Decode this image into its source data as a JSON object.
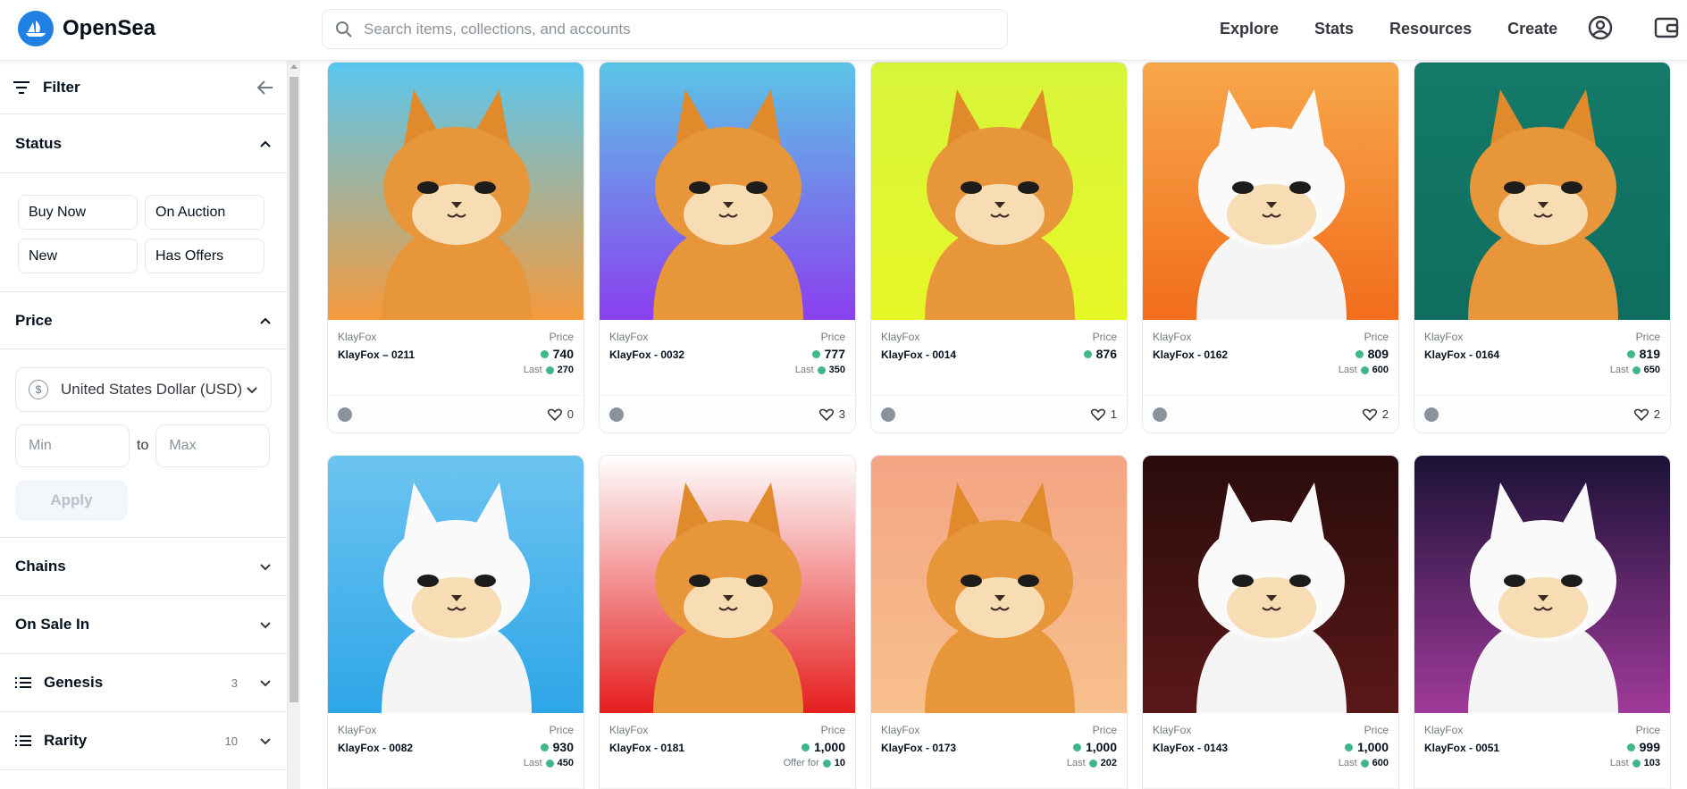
{
  "brand": {
    "name": "OpenSea",
    "color": "#2081e2"
  },
  "search": {
    "placeholder": "Search items, collections, and accounts"
  },
  "nav": {
    "explore": "Explore",
    "stats": "Stats",
    "resources": "Resources",
    "create": "Create"
  },
  "sidebar": {
    "filter_label": "Filter",
    "status_title": "Status",
    "status_options": [
      "Buy Now",
      "On Auction",
      "New",
      "Has Offers"
    ],
    "price_title": "Price",
    "currency_symbol": "$",
    "currency": "United States Dollar (USD)",
    "min_placeholder": "Min",
    "max_placeholder": "Max",
    "to": "to",
    "apply": "Apply",
    "chains": "Chains",
    "on_sale_in": "On Sale In",
    "genesis": {
      "label": "Genesis",
      "count": "3"
    },
    "rarity": {
      "label": "Rarity",
      "count": "10"
    }
  },
  "price_label": "Price",
  "cards": [
    {
      "collection": "KlayFox",
      "name": "KlayFox – 0211",
      "price": "740",
      "sub_label": "Last",
      "sub_value": "270",
      "likes": "0",
      "bg": [
        "#58c7f0",
        "#f59a3c"
      ],
      "accessory": "campfire"
    },
    {
      "collection": "KlayFox",
      "name": "KlayFox - 0032",
      "price": "777",
      "sub_label": "Last",
      "sub_value": "350",
      "likes": "3",
      "bg": [
        "#5bc6e6",
        "#8b3ff0"
      ],
      "accessory": "tshirt"
    },
    {
      "collection": "KlayFox",
      "name": "KlayFox - 0014",
      "price": "876",
      "sub_label": "",
      "sub_value": "",
      "likes": "1",
      "bg": [
        "#d8f53a",
        "#e6f726"
      ],
      "accessory": "goggles"
    },
    {
      "collection": "KlayFox",
      "name": "KlayFox - 0162",
      "price": "809",
      "sub_label": "Last",
      "sub_value": "600",
      "likes": "2",
      "bg": [
        "#f7a74a",
        "#f26d1c"
      ],
      "accessory": "mask"
    },
    {
      "collection": "KlayFox",
      "name": "KlayFox - 0164",
      "price": "819",
      "sub_label": "Last",
      "sub_value": "650",
      "likes": "2",
      "bg": [
        "#147a6a",
        "#0f6d5f"
      ],
      "accessory": "hanbok"
    },
    {
      "collection": "KlayFox",
      "name": "KlayFox - 0082",
      "price": "930",
      "sub_label": "Last",
      "sub_value": "450",
      "likes": "",
      "bg": [
        "#6cc4f0",
        "#2ea6e8"
      ],
      "accessory": "penguin"
    },
    {
      "collection": "KlayFox",
      "name": "KlayFox - 0181",
      "price": "1,000",
      "sub_label": "Offer for",
      "sub_value": "10",
      "likes": "",
      "bg": [
        "#ffffff",
        "#e61e1e"
      ],
      "accessory": "bitcoin"
    },
    {
      "collection": "KlayFox",
      "name": "KlayFox - 0173",
      "price": "1,000",
      "sub_label": "Last",
      "sub_value": "202",
      "likes": "",
      "bg": [
        "#f4a583",
        "#f7c08c"
      ],
      "accessory": "blossom"
    },
    {
      "collection": "KlayFox",
      "name": "KlayFox - 0143",
      "price": "1,000",
      "sub_label": "Last",
      "sub_value": "600",
      "likes": "",
      "bg": [
        "#2a0c0c",
        "#5a1818"
      ],
      "accessory": "umbrella"
    },
    {
      "collection": "KlayFox",
      "name": "KlayFox - 0051",
      "price": "999",
      "sub_label": "Last",
      "sub_value": "103",
      "likes": "",
      "bg": [
        "#1b1236",
        "#a03a9a"
      ],
      "accessory": "astronaut"
    }
  ]
}
